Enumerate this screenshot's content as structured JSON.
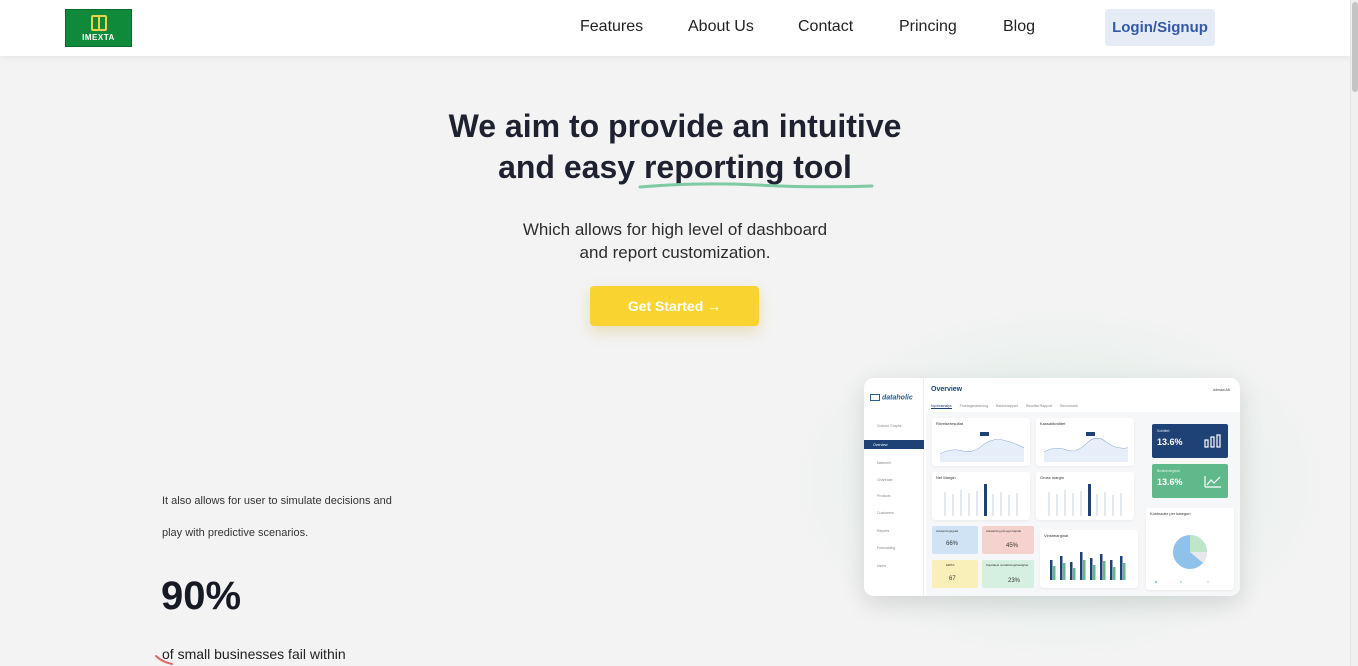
{
  "header": {
    "logo_text": "IMEXTA",
    "logo_subtext": "",
    "nav": [
      "Features",
      "About Us",
      "Contact",
      "Princing",
      "Blog"
    ],
    "login_label": "Login/Signup"
  },
  "hero": {
    "title_line1": "We aim to provide an intuitive",
    "title_line2_prefix": "and easy ",
    "title_line2_highlight": "reporting tool",
    "subtitle_line1": "Which allows for high level of dashboard",
    "subtitle_line2": "and report customization.",
    "cta_label": "Get Started →"
  },
  "stats": {
    "line1": "It also allows for user to simulate decisions and",
    "line2": "play with predictive scenarios.",
    "percent": "90%",
    "caption": "of small businesses fail within"
  },
  "dashboard": {
    "brand": "dataholic",
    "title": "Overview",
    "company": "Adessa AB",
    "tabs": [
      "Nyckelanalys",
      "Företagsvärdering",
      "Balansrapport",
      "Resultat Rapport",
      "Benchmark"
    ],
    "nav": [
      "Custom Graphs",
      "Overview",
      "Nationell",
      "Chartrade",
      "Products",
      "Customers",
      "Reports",
      "Forecasting",
      "Users"
    ],
    "cards": [
      "Rörelseresultat",
      "Kassalikviditet",
      "Net Margin",
      "Gross margin",
      "Vinstmarginal",
      "Kostnader per kategori"
    ],
    "kpis": [
      {
        "label": "Avkastningsgrad",
        "value": "66%"
      },
      {
        "label": "Avkastning på eget kapital",
        "value": "45%"
      },
      {
        "label": "EBITA",
        "value": "67"
      },
      {
        "label": "Kapitalets omsättningshastighet",
        "value": "23%"
      }
    ],
    "big_kpis": [
      {
        "label": "Soliditet",
        "value": "13.6%"
      },
      {
        "label": "Bruttomarginal",
        "value": "13.6%"
      }
    ],
    "colors": {
      "navy": "#1e4275",
      "green": "#5fb98a",
      "blue_kpi": "#cfe3f5",
      "red_kpi": "#f6d2cf",
      "yellow_kpi": "#f8f0b8",
      "mint_kpi": "#d5efe0"
    }
  }
}
